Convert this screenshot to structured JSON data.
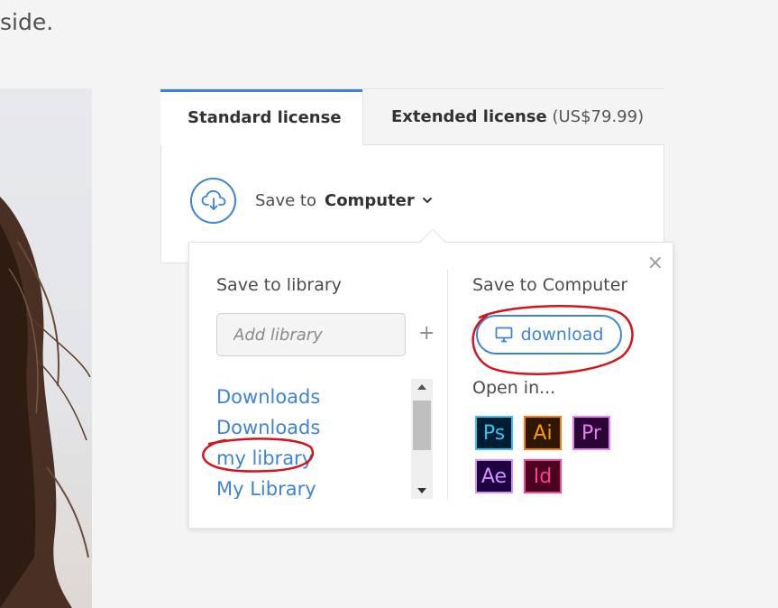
{
  "page": {
    "intro_tail": "side."
  },
  "license_tabs": {
    "standard": "Standard license",
    "extended_name": "Extended license",
    "extended_price": "(US$79.99)"
  },
  "save_to": {
    "label": "Save to",
    "value": "Computer"
  },
  "popover": {
    "close": "×",
    "library": {
      "title": "Save to library",
      "add_placeholder": "Add library",
      "add_plus": "+",
      "items": [
        "Downloads",
        "Downloads",
        "my library",
        "My Library"
      ]
    },
    "computer": {
      "title": "Save to Computer",
      "download_label": "download",
      "open_in_label": "Open in...",
      "apps": [
        "Ps",
        "Ai",
        "Pr",
        "Ae",
        "Id"
      ]
    }
  },
  "colors": {
    "accent": "#3d84d6",
    "annotation": "#d4141c",
    "ps": "#31c5f0",
    "ai": "#ff7c00",
    "pr": "#e77bf6",
    "ae": "#d291ff",
    "id": "#ff3f94"
  },
  "icons": {
    "cloud": "cloud-download-icon",
    "chevron": "chevron-down-icon",
    "close": "close-icon",
    "monitor": "monitor-icon"
  }
}
